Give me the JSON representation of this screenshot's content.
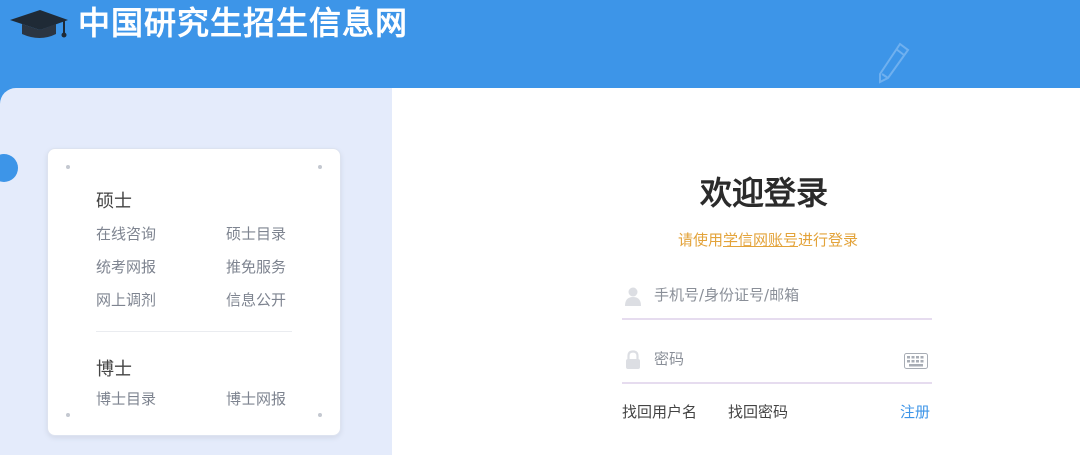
{
  "header": {
    "site_title": "中国研究生招生信息网",
    "logo_icon": "graduation-cap-icon",
    "decor_icon": "pencil-icon"
  },
  "nav_card": {
    "masters": {
      "title": "硕士",
      "links": [
        "在线咨询",
        "硕士目录",
        "统考网报",
        "推免服务",
        "网上调剂",
        "信息公开"
      ]
    },
    "doctoral": {
      "title": "博士",
      "links": [
        "博士目录",
        "博士网报"
      ]
    }
  },
  "login": {
    "title": "欢迎登录",
    "subtitle_prefix": "请使用",
    "subtitle_account": "学信网账号",
    "subtitle_suffix": "进行登录",
    "username_placeholder": "手机号/身份证号/邮箱",
    "password_placeholder": "密码",
    "find_username": "找回用户名",
    "find_password": "找回密码",
    "register": "注册"
  },
  "colors": {
    "brand_blue": "#3d95e8",
    "hint_orange": "#e3a33a",
    "panel_bg": "#e4ebfb"
  }
}
